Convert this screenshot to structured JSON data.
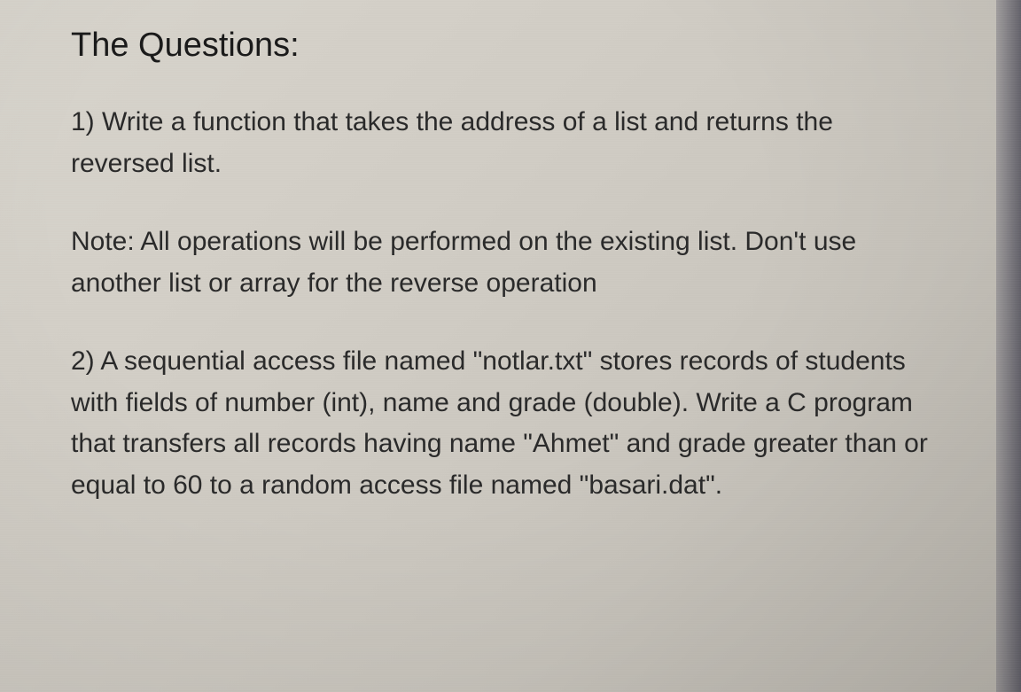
{
  "heading": "The Questions:",
  "q1": "1) Write a function that takes the address of a list and returns the reversed list.",
  "note": "Note: All operations will be performed on the existing list. Don't use another list or array for the reverse operation",
  "q2": "2) A sequential access file named \"notlar.txt\" stores records of students with fields of number (int), name and grade (double). Write a C program that transfers all records having name \"Ahmet\" and grade greater than or equal to 60 to a random access file named \"basari.dat\"."
}
